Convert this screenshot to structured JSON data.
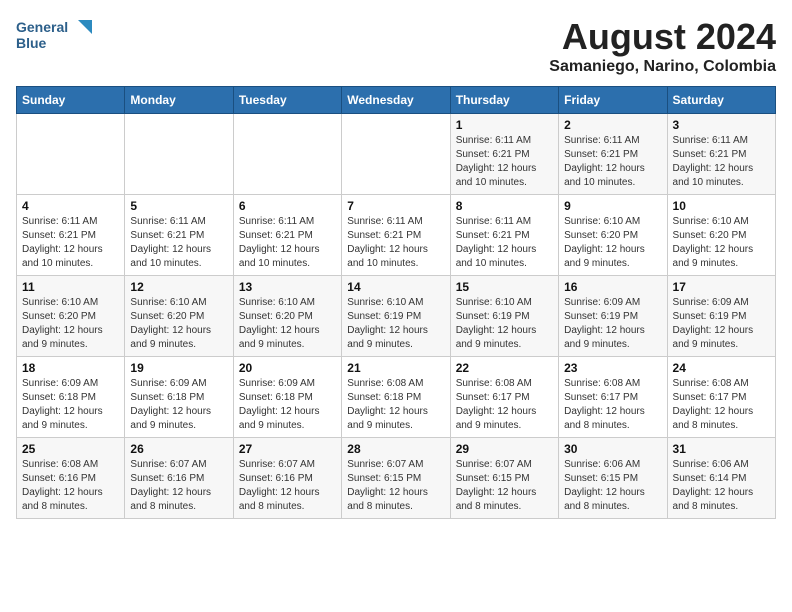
{
  "logo": {
    "line1": "General",
    "line2": "Blue"
  },
  "title": "August 2024",
  "subtitle": "Samaniego, Narino, Colombia",
  "days_of_week": [
    "Sunday",
    "Monday",
    "Tuesday",
    "Wednesday",
    "Thursday",
    "Friday",
    "Saturday"
  ],
  "weeks": [
    [
      {
        "day": "",
        "info": ""
      },
      {
        "day": "",
        "info": ""
      },
      {
        "day": "",
        "info": ""
      },
      {
        "day": "",
        "info": ""
      },
      {
        "day": "1",
        "info": "Sunrise: 6:11 AM\nSunset: 6:21 PM\nDaylight: 12 hours and 10 minutes."
      },
      {
        "day": "2",
        "info": "Sunrise: 6:11 AM\nSunset: 6:21 PM\nDaylight: 12 hours and 10 minutes."
      },
      {
        "day": "3",
        "info": "Sunrise: 6:11 AM\nSunset: 6:21 PM\nDaylight: 12 hours and 10 minutes."
      }
    ],
    [
      {
        "day": "4",
        "info": "Sunrise: 6:11 AM\nSunset: 6:21 PM\nDaylight: 12 hours and 10 minutes."
      },
      {
        "day": "5",
        "info": "Sunrise: 6:11 AM\nSunset: 6:21 PM\nDaylight: 12 hours and 10 minutes."
      },
      {
        "day": "6",
        "info": "Sunrise: 6:11 AM\nSunset: 6:21 PM\nDaylight: 12 hours and 10 minutes."
      },
      {
        "day": "7",
        "info": "Sunrise: 6:11 AM\nSunset: 6:21 PM\nDaylight: 12 hours and 10 minutes."
      },
      {
        "day": "8",
        "info": "Sunrise: 6:11 AM\nSunset: 6:21 PM\nDaylight: 12 hours and 10 minutes."
      },
      {
        "day": "9",
        "info": "Sunrise: 6:10 AM\nSunset: 6:20 PM\nDaylight: 12 hours and 9 minutes."
      },
      {
        "day": "10",
        "info": "Sunrise: 6:10 AM\nSunset: 6:20 PM\nDaylight: 12 hours and 9 minutes."
      }
    ],
    [
      {
        "day": "11",
        "info": "Sunrise: 6:10 AM\nSunset: 6:20 PM\nDaylight: 12 hours and 9 minutes."
      },
      {
        "day": "12",
        "info": "Sunrise: 6:10 AM\nSunset: 6:20 PM\nDaylight: 12 hours and 9 minutes."
      },
      {
        "day": "13",
        "info": "Sunrise: 6:10 AM\nSunset: 6:20 PM\nDaylight: 12 hours and 9 minutes."
      },
      {
        "day": "14",
        "info": "Sunrise: 6:10 AM\nSunset: 6:19 PM\nDaylight: 12 hours and 9 minutes."
      },
      {
        "day": "15",
        "info": "Sunrise: 6:10 AM\nSunset: 6:19 PM\nDaylight: 12 hours and 9 minutes."
      },
      {
        "day": "16",
        "info": "Sunrise: 6:09 AM\nSunset: 6:19 PM\nDaylight: 12 hours and 9 minutes."
      },
      {
        "day": "17",
        "info": "Sunrise: 6:09 AM\nSunset: 6:19 PM\nDaylight: 12 hours and 9 minutes."
      }
    ],
    [
      {
        "day": "18",
        "info": "Sunrise: 6:09 AM\nSunset: 6:18 PM\nDaylight: 12 hours and 9 minutes."
      },
      {
        "day": "19",
        "info": "Sunrise: 6:09 AM\nSunset: 6:18 PM\nDaylight: 12 hours and 9 minutes."
      },
      {
        "day": "20",
        "info": "Sunrise: 6:09 AM\nSunset: 6:18 PM\nDaylight: 12 hours and 9 minutes."
      },
      {
        "day": "21",
        "info": "Sunrise: 6:08 AM\nSunset: 6:18 PM\nDaylight: 12 hours and 9 minutes."
      },
      {
        "day": "22",
        "info": "Sunrise: 6:08 AM\nSunset: 6:17 PM\nDaylight: 12 hours and 9 minutes."
      },
      {
        "day": "23",
        "info": "Sunrise: 6:08 AM\nSunset: 6:17 PM\nDaylight: 12 hours and 8 minutes."
      },
      {
        "day": "24",
        "info": "Sunrise: 6:08 AM\nSunset: 6:17 PM\nDaylight: 12 hours and 8 minutes."
      }
    ],
    [
      {
        "day": "25",
        "info": "Sunrise: 6:08 AM\nSunset: 6:16 PM\nDaylight: 12 hours and 8 minutes."
      },
      {
        "day": "26",
        "info": "Sunrise: 6:07 AM\nSunset: 6:16 PM\nDaylight: 12 hours and 8 minutes."
      },
      {
        "day": "27",
        "info": "Sunrise: 6:07 AM\nSunset: 6:16 PM\nDaylight: 12 hours and 8 minutes."
      },
      {
        "day": "28",
        "info": "Sunrise: 6:07 AM\nSunset: 6:15 PM\nDaylight: 12 hours and 8 minutes."
      },
      {
        "day": "29",
        "info": "Sunrise: 6:07 AM\nSunset: 6:15 PM\nDaylight: 12 hours and 8 minutes."
      },
      {
        "day": "30",
        "info": "Sunrise: 6:06 AM\nSunset: 6:15 PM\nDaylight: 12 hours and 8 minutes."
      },
      {
        "day": "31",
        "info": "Sunrise: 6:06 AM\nSunset: 6:14 PM\nDaylight: 12 hours and 8 minutes."
      }
    ]
  ]
}
